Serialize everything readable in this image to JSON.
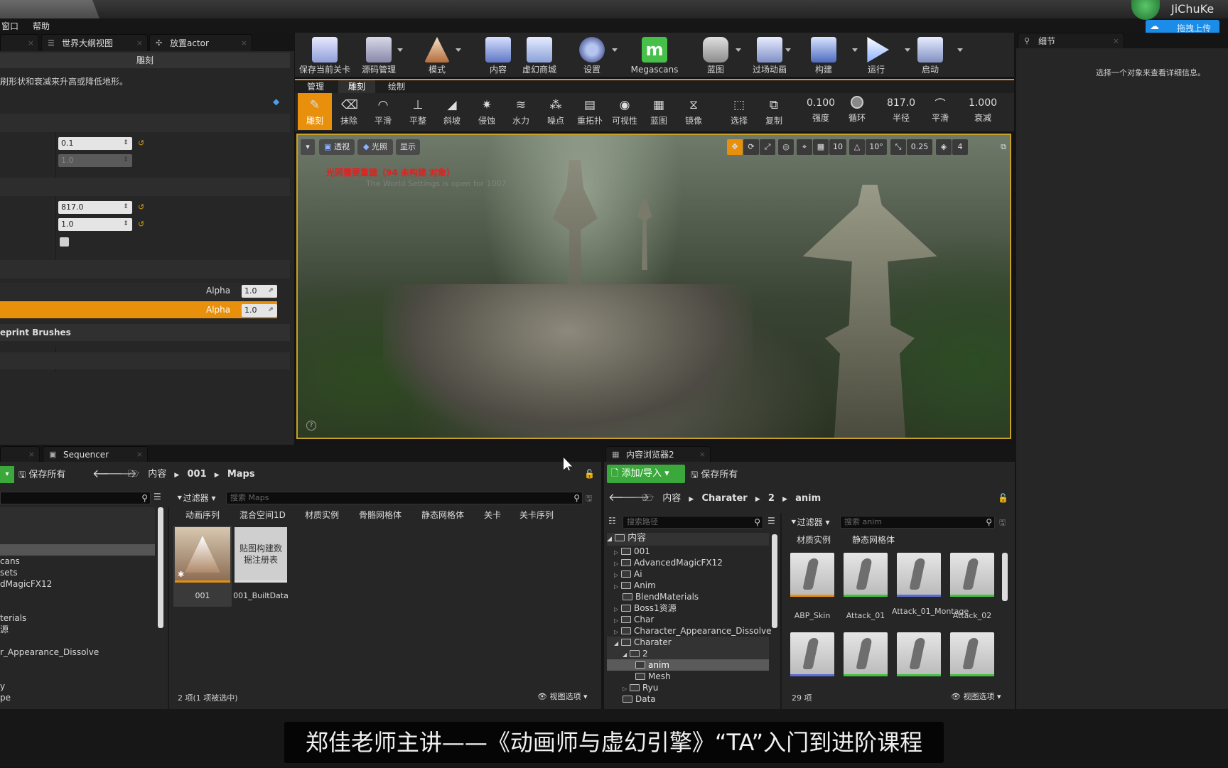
{
  "menu": {
    "window": "窗口",
    "help": "帮助"
  },
  "watermark": {
    "brand": "JiChuKe",
    "upload": "拖拽上传"
  },
  "left_tabs": {
    "world_outliner": "世界大纲视图",
    "place_actor": "放置actor"
  },
  "modes_panel": {
    "section_title": "雕刻",
    "description": "刷形状和衰减来升高或降低地形。",
    "field1": "0.1",
    "field2": "1.0",
    "field3": "817.0",
    "field4": "1.0",
    "alpha_label": "Alpha",
    "alpha_value": "1.0",
    "alpha_label_2": "Alpha",
    "alpha_value_2": "1.0",
    "blueprint_brushes": "eprint Brushes"
  },
  "toolbar": {
    "buttons": [
      {
        "label": "保存当前关卡",
        "icon": "save-icon"
      },
      {
        "label": "源码管理",
        "icon": "source-control-icon"
      },
      {
        "label": "模式",
        "icon": "modes-icon"
      },
      {
        "label": "内容",
        "icon": "content-icon"
      },
      {
        "label": "虚幻商城",
        "icon": "marketplace-icon"
      },
      {
        "label": "设置",
        "icon": "settings-icon"
      },
      {
        "label": "Megascans",
        "icon": "megascans-icon"
      },
      {
        "label": "蓝图",
        "icon": "blueprint-icon"
      },
      {
        "label": "过场动画",
        "icon": "cinematics-icon"
      },
      {
        "label": "构建",
        "icon": "build-icon"
      },
      {
        "label": "运行",
        "icon": "play-icon"
      },
      {
        "label": "启动",
        "icon": "launch-icon"
      }
    ]
  },
  "landscape_tabs": {
    "manage": "管理",
    "sculpt": "雕刻",
    "paint": "绘制"
  },
  "sculpt_tools": [
    {
      "label": "雕刻",
      "icon": "sculpt-brush-icon"
    },
    {
      "label": "抹除",
      "icon": "erase-icon"
    },
    {
      "label": "平滑",
      "icon": "smooth-icon"
    },
    {
      "label": "平整",
      "icon": "flatten-icon"
    },
    {
      "label": "斜坡",
      "icon": "ramp-icon"
    },
    {
      "label": "侵蚀",
      "icon": "erosion-icon"
    },
    {
      "label": "水力",
      "icon": "hydro-icon"
    },
    {
      "label": "噪点",
      "icon": "noise-icon"
    },
    {
      "label": "重拓扑",
      "icon": "retopo-icon"
    },
    {
      "label": "可视性",
      "icon": "visibility-icon"
    },
    {
      "label": "蓝图",
      "icon": "blueprint-tool-icon"
    },
    {
      "label": "镜像",
      "icon": "mirror-icon"
    },
    {
      "label": "选择",
      "icon": "select-icon"
    },
    {
      "label": "复制",
      "icon": "copy-icon"
    }
  ],
  "brush_settings": {
    "strength_value": "0.100",
    "strength_label": "强度",
    "loop_label": "循环",
    "radius_value": "817.0",
    "radius_label": "半径",
    "smooth_label": "平滑",
    "falloff_value": "1.000",
    "falloff_label": "衰减"
  },
  "viewport": {
    "perspective": "透视",
    "lit": "光照",
    "show": "显示",
    "grid": "10",
    "angle": "10°",
    "scale": "0.25",
    "speed": "4",
    "warning": "光照需要重建（94 未构建 对象）",
    "sub_warning": "The World Settings is open for 1007"
  },
  "details_panel": {
    "tab": "细节",
    "empty_msg": "选择一个对象来查看详细信息。"
  },
  "sequencer": {
    "tab": "Sequencer"
  },
  "left_browser": {
    "save_all": "保存所有",
    "path": [
      "内容",
      "001",
      "Maps"
    ],
    "filter": "过滤器",
    "search_placeholder": "搜索 Maps",
    "chips": [
      "动画序列",
      "混合空间1D",
      "材质实例",
      "骨骼网格体",
      "静态网格体",
      "关卡",
      "关卡序列"
    ],
    "tree": [
      "cans",
      "sets",
      "dMagicFX12",
      "terials",
      "源",
      "r_Appearance_Dissolve",
      "y",
      "pe"
    ],
    "assets": [
      {
        "label": "001"
      },
      {
        "label": "001_BuiltData",
        "thumb_text": "贴图构建数据注册表"
      }
    ],
    "status": "2 项(1 项被选中)",
    "view_options": "视图选项"
  },
  "content_browser2": {
    "tab": "内容浏览器2",
    "add_import": "添加/导入",
    "save_all": "保存所有",
    "path": [
      "内容",
      "Charater",
      "2",
      "anim"
    ],
    "path_search_placeholder": "搜索路径",
    "filter": "过滤器",
    "search_placeholder": "搜索 anim",
    "chips": [
      "材质实例",
      "静态网格体"
    ],
    "tree": [
      "内容",
      "001",
      "AdvancedMagicFX12",
      "Ai",
      "Anim",
      "BlendMaterials",
      "Boss1资源",
      "Char",
      "Character_Appearance_Dissolve",
      "Charater",
      "2",
      "anim",
      "Mesh",
      "Ryu",
      "Data"
    ],
    "assets": [
      "ABP_Skin",
      "Attack_01",
      "Attack_01_Montage",
      "Attack_02"
    ],
    "count": "29 项",
    "view_options": "视图选项"
  },
  "subtitle": "郑佳老师主讲——《动画师与虚幻引擎》“TA”入门到进阶课程"
}
